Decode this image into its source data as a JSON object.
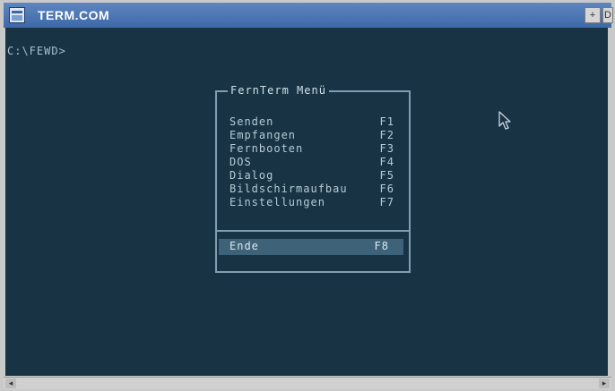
{
  "window": {
    "title": "TERM.COM",
    "buttons": [
      "+",
      "D"
    ],
    "icons": {
      "system": "app-window-icon",
      "cursor": "mouse-pointer-icon"
    }
  },
  "terminal": {
    "prompt": "C:\\FEWD>",
    "colors": {
      "background": "#173344",
      "text": "#b7ccd6",
      "frame": "#7f9eb0",
      "highlight": "#3e6278"
    }
  },
  "menu": {
    "title": "FernTerm Menü",
    "items": [
      {
        "label": "Senden",
        "key": "F1"
      },
      {
        "label": "Empfangen",
        "key": "F2"
      },
      {
        "label": "Fernbooten",
        "key": "F3"
      },
      {
        "label": "DOS",
        "key": "F4"
      },
      {
        "label": "Dialog",
        "key": "F5"
      },
      {
        "label": "Bildschirmaufbau",
        "key": "F6"
      },
      {
        "label": "Einstellungen",
        "key": "F7"
      }
    ],
    "exit": {
      "label": "Ende",
      "key": "F8"
    }
  },
  "scrollbar": {
    "left": "◂",
    "right": "▸"
  }
}
